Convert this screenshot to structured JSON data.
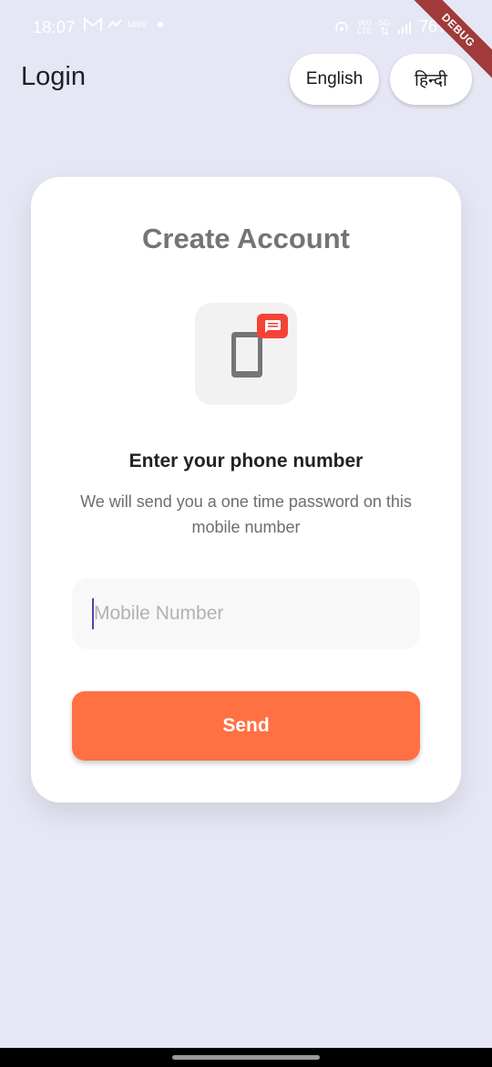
{
  "status_bar": {
    "time": "18:07",
    "left_icons": [
      "gmail-icon",
      "signal-app-icon"
    ],
    "left_small_text": "MMS",
    "network_label_top": "Vo0",
    "network_label_bottom": "LTE",
    "network_type": "5G",
    "battery": "76%"
  },
  "debug_banner": "DEBUG",
  "app_bar": {
    "title": "Login",
    "lang_english": "English",
    "lang_hindi": "हिन्दी"
  },
  "card": {
    "title": "Create Account",
    "icon": "phone-message-icon",
    "prompt": "Enter your phone number",
    "description": "We will send you a one time password on this mobile number",
    "mobile_placeholder": "Mobile Number",
    "mobile_value": "",
    "send_label": "Send"
  },
  "colors": {
    "background": "#e6e7f4",
    "accent": "#ff7043",
    "badge": "#f44336",
    "title_gray": "#747474"
  }
}
